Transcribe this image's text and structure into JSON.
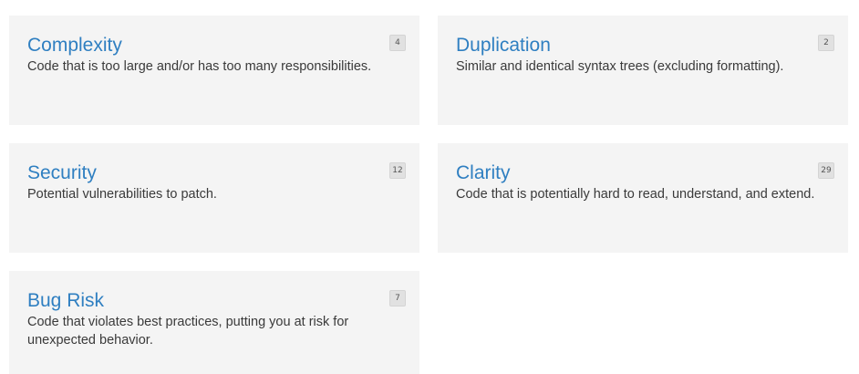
{
  "categories": [
    {
      "title": "Complexity",
      "description": "Code that is too large and/or has too many responsibilities.",
      "count": "4"
    },
    {
      "title": "Duplication",
      "description": "Similar and identical syntax trees (excluding formatting).",
      "count": "2"
    },
    {
      "title": "Security",
      "description": "Potential vulnerabilities to patch.",
      "count": "12"
    },
    {
      "title": "Clarity",
      "description": "Code that is potentially hard to read, understand, and extend.",
      "count": "29"
    },
    {
      "title": "Bug Risk",
      "description": "Code that violates best practices, putting you at risk for unexpected behavior.",
      "count": "7"
    }
  ],
  "colors": {
    "title": "#2f7fc1",
    "card_background": "#f4f4f4",
    "badge_background": "#e1e1e1",
    "text": "#3a3a3a"
  }
}
